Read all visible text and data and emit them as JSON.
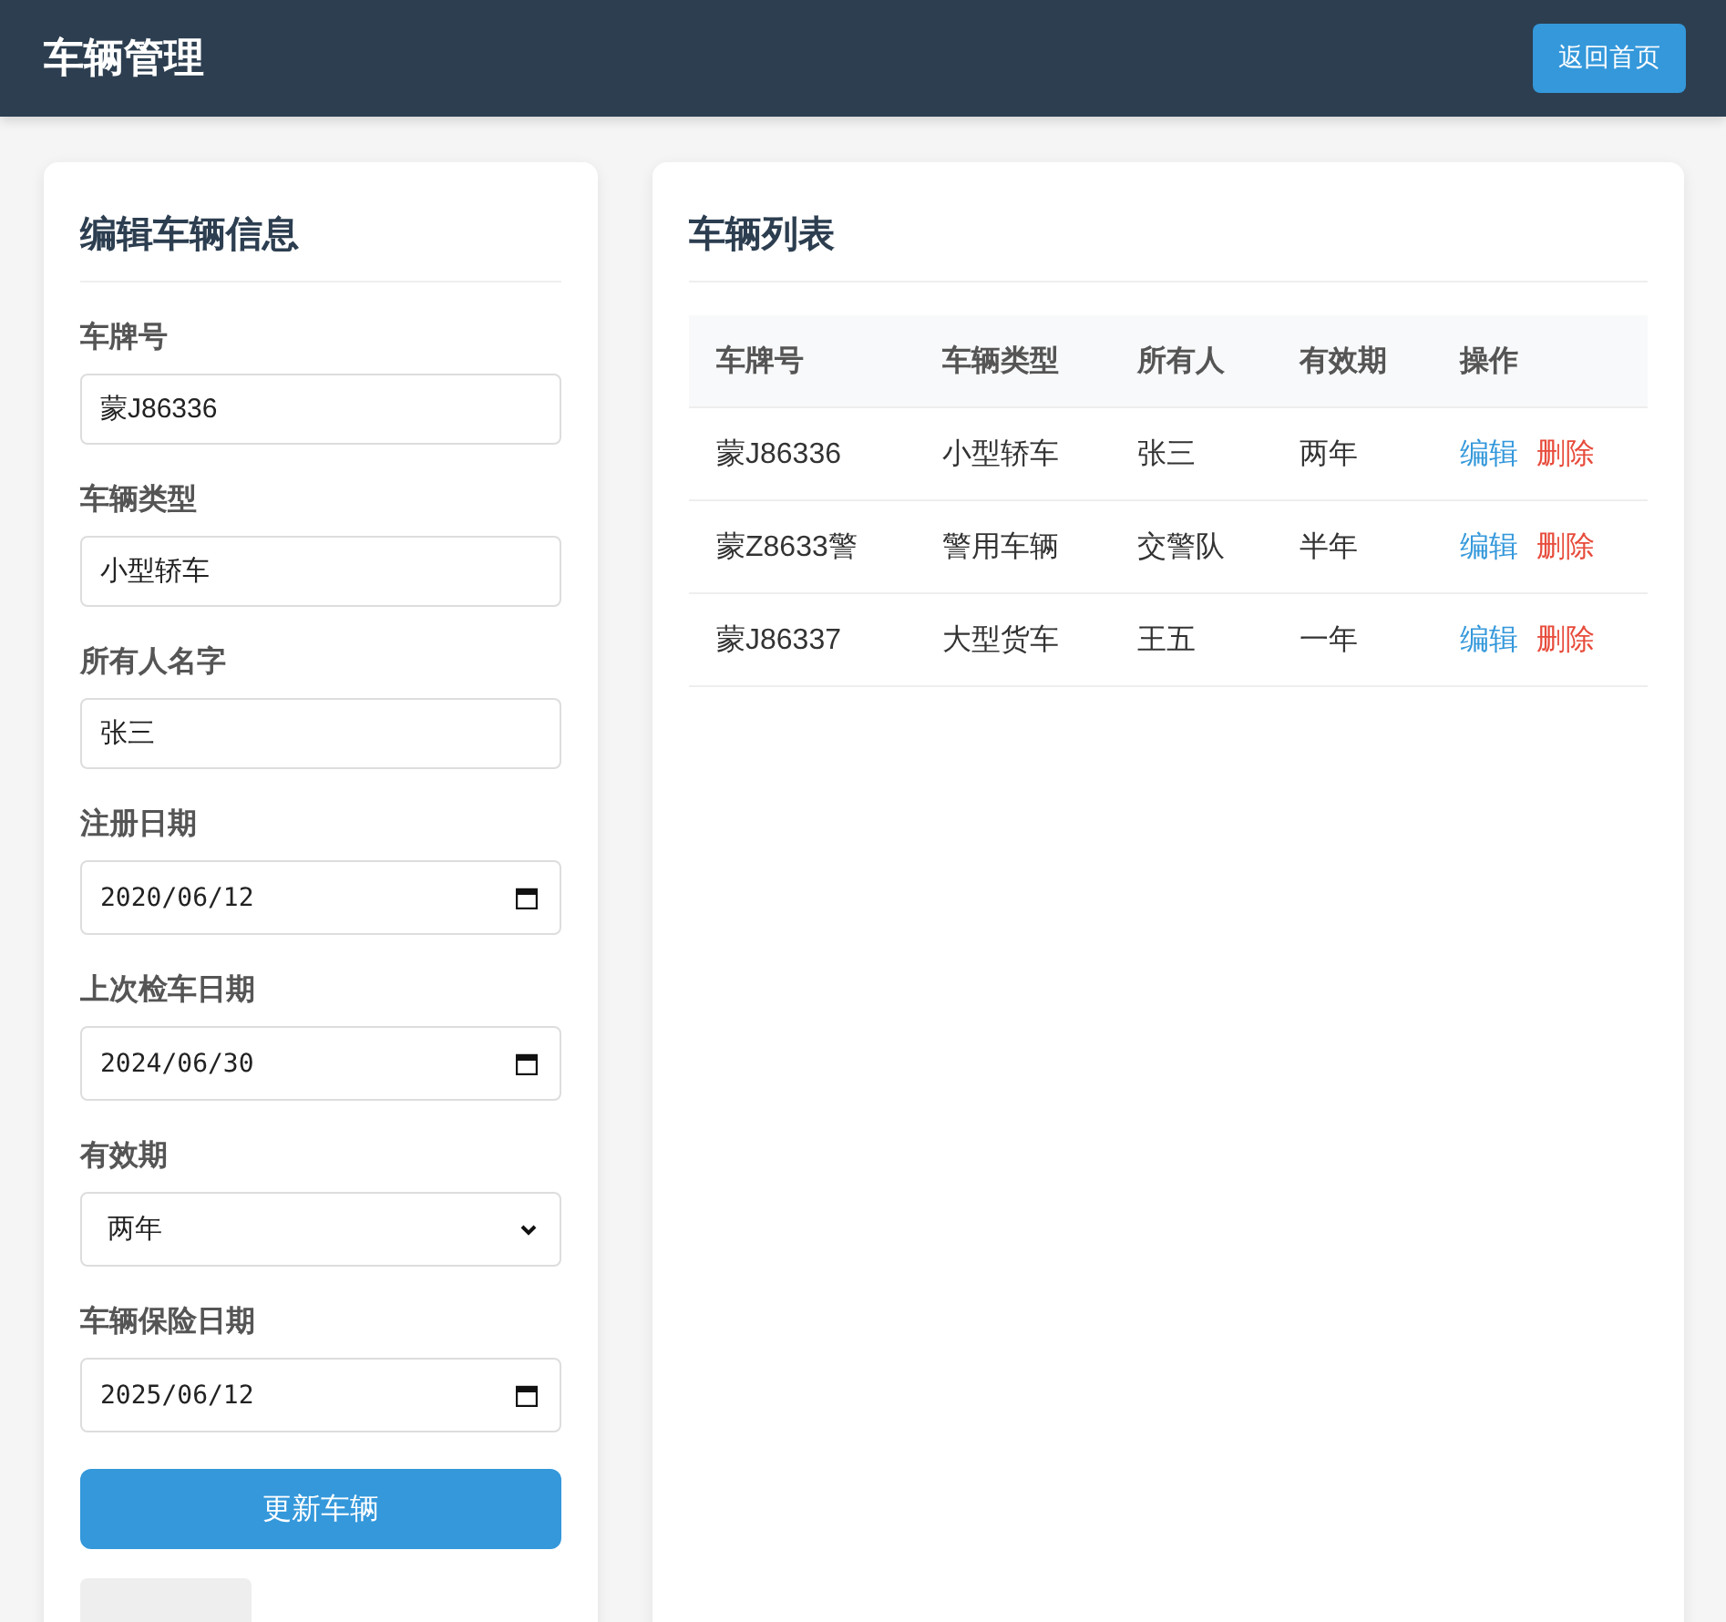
{
  "header": {
    "title": "车辆管理",
    "button": "返回首页"
  },
  "form": {
    "title": "编辑车辆信息",
    "fields": [
      {
        "kind": "text",
        "label": "车牌号",
        "value": "蒙J86336"
      },
      {
        "kind": "text",
        "label": "车辆类型",
        "value": "小型轿车"
      },
      {
        "kind": "text",
        "label": "所有人名字",
        "value": "张三"
      },
      {
        "kind": "date",
        "label": "注册日期",
        "value": "2020/06/12"
      },
      {
        "kind": "date",
        "label": "上次检车日期",
        "value": "2024/06/30"
      },
      {
        "kind": "select",
        "label": "有效期",
        "value": "两年"
      },
      {
        "kind": "date",
        "label": "车辆保险日期",
        "value": "2025/06/12"
      }
    ],
    "submit": "更新车辆"
  },
  "list": {
    "title": "车辆列表",
    "columns": [
      "车牌号",
      "车辆类型",
      "所有人",
      "有效期",
      "操作"
    ],
    "rows": [
      {
        "cells": [
          "蒙J86336",
          "小型轿车",
          "张三",
          "两年"
        ],
        "actions": [
          "编辑",
          "删除"
        ]
      },
      {
        "cells": [
          "蒙Z8633警",
          "警用车辆",
          "交警队",
          "半年"
        ],
        "actions": [
          "编辑",
          "删除"
        ]
      },
      {
        "cells": [
          "蒙J86337",
          "大型货车",
          "王五",
          "一年"
        ],
        "actions": [
          "编辑",
          "删除"
        ]
      }
    ]
  }
}
